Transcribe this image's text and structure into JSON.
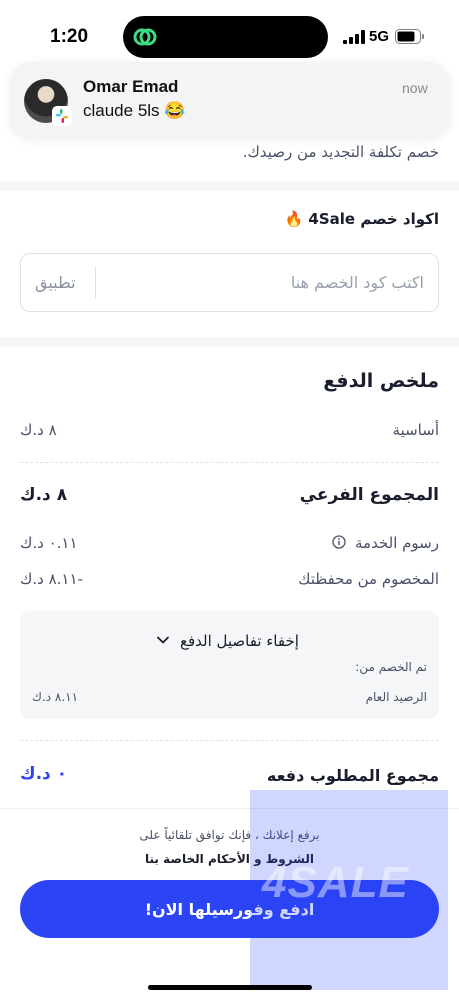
{
  "status_bar": {
    "time": "1:20",
    "network": "5G",
    "signal_icon": "signal-bars-icon",
    "battery_icon": "battery-icon"
  },
  "notification": {
    "sender": "Omar Emad",
    "message": "claude 5ls 😂",
    "time": "now",
    "app_icon": "slack-icon"
  },
  "renewal_notice": "خصم تكلفة التجديد من رصيدك.",
  "promo": {
    "title": "اكواد خصم 4Sale 🔥",
    "placeholder": "اكتب كود الخصم هنا",
    "apply_label": "تطبيق"
  },
  "summary": {
    "title": "ملخص الدفع",
    "rows": [
      {
        "label": "أساسية",
        "value": "٨ د.ك"
      }
    ],
    "subtotal": {
      "label": "المجموع الفرعي",
      "value": "٨ د.ك"
    },
    "service_fee": {
      "label": "رسوم الخدمة",
      "value": "٠.١١ د.ك"
    },
    "wallet_deduction": {
      "label": "المخصوم من محفظتك",
      "value": "-٨.١١ د.ك"
    },
    "details": {
      "toggle_label": "إخفاء تفاصيل الدفع",
      "deducted_from": "تم الخصم من:",
      "balance_label": "الرصيد العام",
      "balance_value": "٨.١١ د.ك"
    },
    "total": {
      "label": "مجموع المطلوب دفعه",
      "value": "٠ د.ك"
    }
  },
  "terms": {
    "line1": "برفع إعلانك ، فإنك توافق تلقائياً على",
    "line2": "الشروط و الأحكام الخاصة بنا"
  },
  "pay_button": "ادفع وفورسيلها الان!",
  "watermark": "4SALE",
  "colors": {
    "accent": "#2b45f5",
    "text": "#1a1d2e",
    "muted": "#4a5068",
    "panel": "#f5f6f8"
  }
}
